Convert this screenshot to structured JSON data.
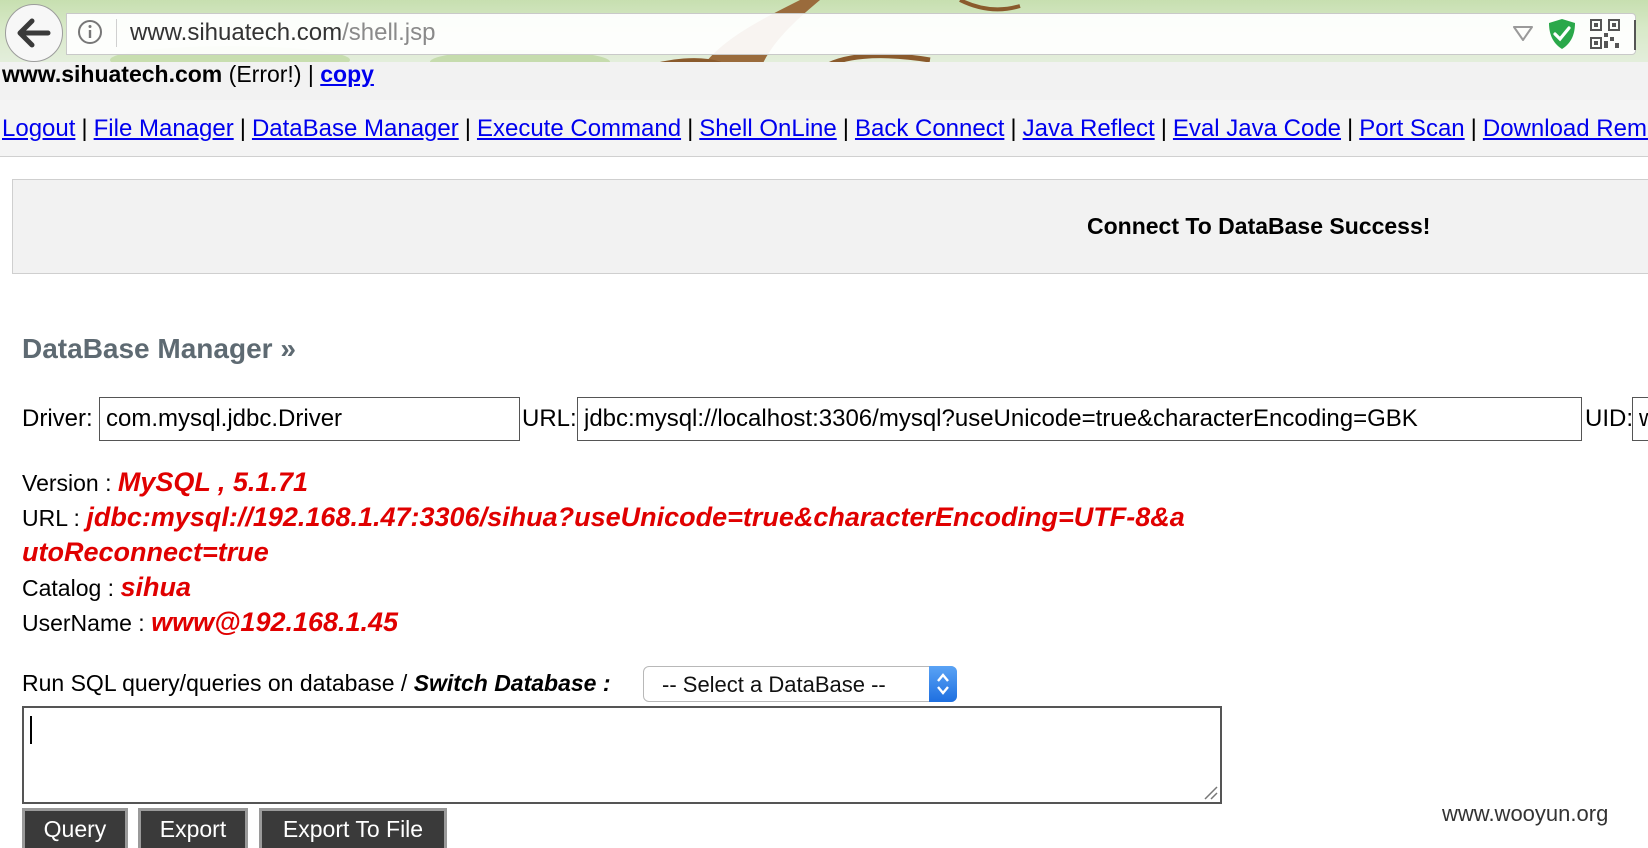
{
  "browser": {
    "url_host": "www.sihuatech.com",
    "url_path": "/shell.jsp"
  },
  "status": {
    "host": "www.sihuatech.com",
    "error": "(Error!)",
    "copy": "copy"
  },
  "nav": {
    "items": [
      "Logout",
      "File Manager",
      "DataBase Manager",
      "Execute Command",
      "Shell OnLine",
      "Back Connect",
      "Java Reflect",
      "Eval Java Code",
      "Port Scan",
      "Download Remote File"
    ],
    "separator": "|"
  },
  "message": "Connect To DataBase Success!",
  "section_title": "DataBase Manager »",
  "connection_form": {
    "driver_label": "Driver:",
    "driver_value": "com.mysql.jdbc.Driver",
    "url_label": "URL:",
    "url_value": "jdbc:mysql://localhost:3306/mysql?useUnicode=true&characterEncoding=GBK",
    "uid_label": "UID:",
    "uid_value": "www"
  },
  "db_info": {
    "version_label": "Version :",
    "version_value": "MySQL , 5.1.71",
    "url_label": "URL :",
    "url_value_line1": "jdbc:mysql://192.168.1.47:3306/sihua?useUnicode=true&characterEncoding=UTF-8&a",
    "url_value_line2": "utoReconnect=true",
    "catalog_label": "Catalog :",
    "catalog_value": "sihua",
    "username_label": "UserName :",
    "username_value": "www@192.168.1.45"
  },
  "sql": {
    "label": "Run SQL query/queries on database / ",
    "switch_label": "Switch Database :",
    "select_value": "-- Select a DataBase --",
    "query_text": ""
  },
  "buttons": {
    "query": "Query",
    "export": "Export",
    "export_to_file": "Export To File"
  },
  "watermark": "www.wooyun.org",
  "colors": {
    "link": "#0000ee",
    "value_red": "#e00000",
    "title_gray": "#5e6a72",
    "button_bg": "#3a3a3a"
  }
}
